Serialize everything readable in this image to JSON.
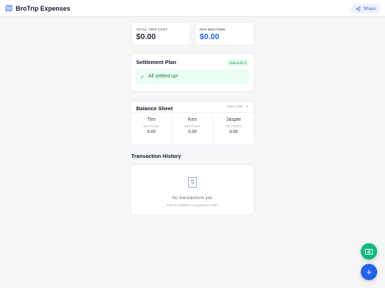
{
  "app": {
    "title": "BroTrip Expenses",
    "share_label": "Share"
  },
  "stats": {
    "total": {
      "label": "TOTAL TRIP COST",
      "value": "$0.00"
    },
    "per_brother": {
      "label": "PER BROTHER",
      "value": "$0.00",
      "color": "#2563eb"
    }
  },
  "settlement": {
    "title": "Settlement Plan",
    "help_badge": "How to fix it",
    "status_text": "All settled up!"
  },
  "balance": {
    "title": "Balance Sheet",
    "show_math_label": "Show Math",
    "people": [
      {
        "name": "Tim",
        "status": "SETTLED",
        "amount": "0.00"
      },
      {
        "name": "Ken",
        "status": "SETTLED",
        "amount": "0.00"
      },
      {
        "name": "Jasper",
        "status": "SETTLED",
        "amount": "0.00"
      }
    ]
  },
  "transactions": {
    "title": "Transaction History",
    "empty_title": "No transactions yet.",
    "empty_subtitle": "Add an expense or payment to start."
  },
  "fabs": {
    "payment_icon": "cash-icon",
    "add_icon": "plus-icon",
    "add_symbol": "+"
  },
  "colors": {
    "accent": "#2563eb",
    "success": "#10b981"
  }
}
